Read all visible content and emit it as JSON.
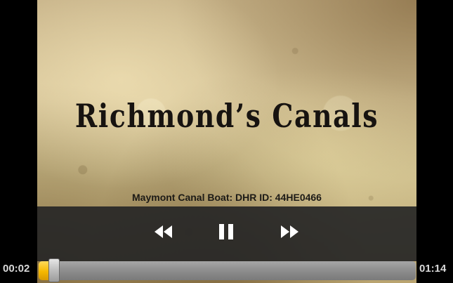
{
  "video": {
    "title": "Richmond’s Canals",
    "caption": "Maymont Canal Boat: DHR ID: 44HE0466"
  },
  "controls": {
    "rewind_icon": "rewind-icon",
    "pause_icon": "pause-icon",
    "forward_icon": "fast-forward-icon"
  },
  "playback": {
    "elapsed": "00:02",
    "total": "01:14",
    "progress_fraction": 0.027
  },
  "colors": {
    "progress": "#f5b800",
    "controls_bg": "#262626",
    "icon": "#ffffff"
  }
}
